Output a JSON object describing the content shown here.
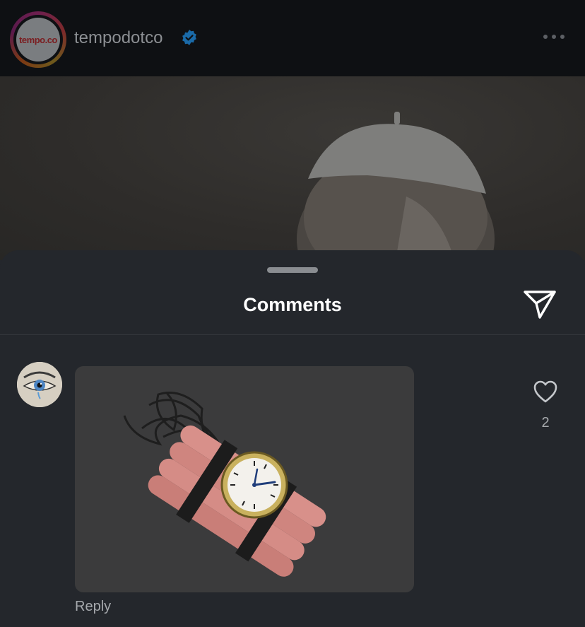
{
  "post": {
    "account_name": "tempodotco",
    "logo_text": "tempo.co",
    "verified": true
  },
  "comments_sheet": {
    "title": "Comments",
    "comments": [
      {
        "like_count": "2",
        "reply_label": "Reply"
      }
    ]
  },
  "icons": {
    "verified": "verified-badge-icon",
    "more": "more-options-icon",
    "share": "paper-plane-icon",
    "like": "heart-icon"
  },
  "colors": {
    "background": "#24272c",
    "header": "#0e1013",
    "verified_blue": "#1a6aa8",
    "muted_text": "#a6a9ad"
  }
}
